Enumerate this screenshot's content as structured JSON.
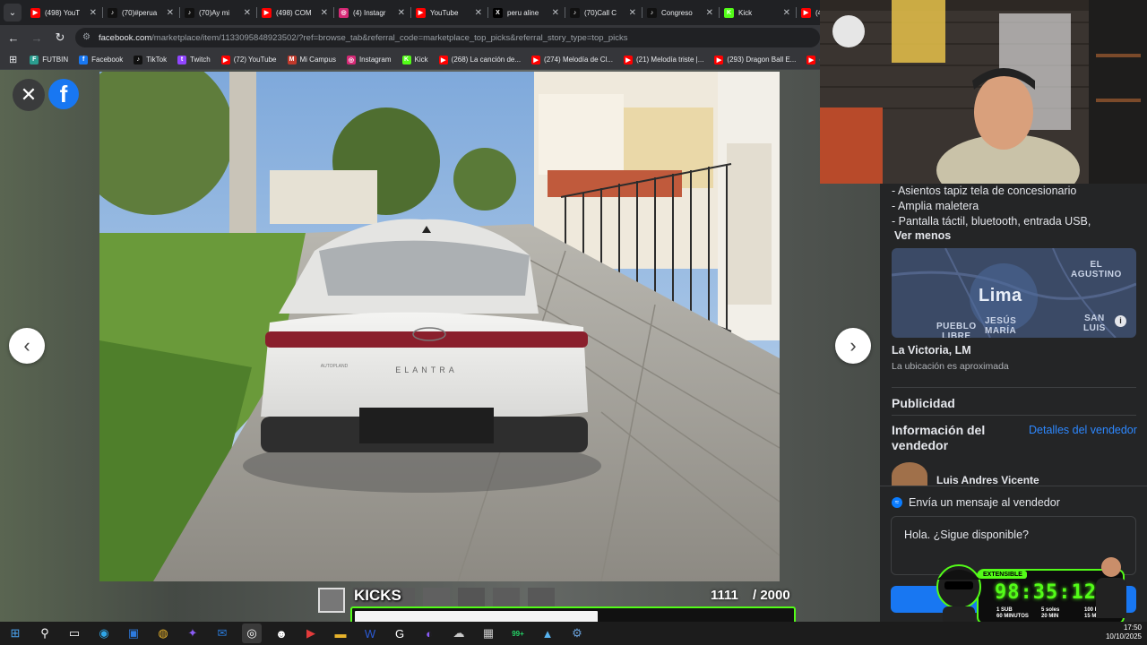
{
  "browser": {
    "tabs": [
      {
        "title": "(498) YouT",
        "icon": "youtube-icon",
        "color": "#ff0000",
        "glyph": "▶"
      },
      {
        "title": "(70)#perua",
        "icon": "tiktok-icon",
        "color": "#111111",
        "glyph": "♪"
      },
      {
        "title": "(70)Ay mi",
        "icon": "tiktok-icon",
        "color": "#111111",
        "glyph": "♪"
      },
      {
        "title": "(498) COM",
        "icon": "youtube-icon",
        "color": "#ff0000",
        "glyph": "▶"
      },
      {
        "title": "(4) Instagr",
        "icon": "instagram-icon",
        "color": "#d62976",
        "glyph": "◎"
      },
      {
        "title": "YouTube",
        "icon": "youtube-icon",
        "color": "#ff0000",
        "glyph": "▶"
      },
      {
        "title": "peru aline",
        "icon": "x-icon",
        "color": "#000000",
        "glyph": "X"
      },
      {
        "title": "(70)Call C",
        "icon": "tiktok-icon",
        "color": "#111111",
        "glyph": "♪"
      },
      {
        "title": "Congreso",
        "icon": "tiktok-icon",
        "color": "#111111",
        "glyph": "♪"
      },
      {
        "title": "Kick",
        "icon": "kick-icon",
        "color": "#53fc18",
        "glyph": "K"
      },
      {
        "title": "(49",
        "icon": "youtube-icon",
        "color": "#ff0000",
        "glyph": "▶"
      }
    ],
    "url_host": "facebook.com",
    "url_path": "/marketplace/item/1133095848923502/?ref=browse_tab&referral_code=marketplace_top_picks&referral_story_type=top_picks",
    "bookmarks": [
      {
        "label": "FUTBIN",
        "color": "#2a9d8f",
        "glyph": "F"
      },
      {
        "label": "Facebook",
        "color": "#1877f2",
        "glyph": "f"
      },
      {
        "label": "TikTok",
        "color": "#111111",
        "glyph": "♪"
      },
      {
        "label": "Twitch",
        "color": "#9146ff",
        "glyph": "t"
      },
      {
        "label": "(72) YouTube",
        "color": "#ff0000",
        "glyph": "▶"
      },
      {
        "label": "Mi Campus",
        "color": "#c0392b",
        "glyph": "M"
      },
      {
        "label": "Instagram",
        "color": "#d62976",
        "glyph": "◎"
      },
      {
        "label": "Kick",
        "color": "#53fc18",
        "glyph": "K"
      },
      {
        "label": "(268) La canción de...",
        "color": "#ff0000",
        "glyph": "▶"
      },
      {
        "label": "(274) Melodía de Cl...",
        "color": "#ff0000",
        "glyph": "▶"
      },
      {
        "label": "(21) Melodía triste |...",
        "color": "#ff0000",
        "glyph": "▶"
      },
      {
        "label": "(293) Dragon Ball E...",
        "color": "#ff0000",
        "glyph": "▶"
      },
      {
        "label": "(",
        "color": "#ff0000",
        "glyph": "▶"
      }
    ]
  },
  "listing": {
    "photo_badge": "ELANTRA",
    "photo_dealer": "AUTOPLAND",
    "description_lines": [
      "- Asientos tapiz tela de concesionario",
      "- Amplia maletera",
      "- Pantalla táctil, bluetooth, entrada USB,"
    ],
    "see_less": "Ver menos",
    "map": {
      "city": "Lima",
      "labels": [
        "EL\nAGUSTINO",
        "PUEBLO\nLIBRE",
        "JESÚS\nMARÍA",
        "SAN\nLUIS"
      ]
    },
    "location": "La Victoria, LM",
    "location_note": "La ubicación es aproximada",
    "ads_heading": "Publicidad",
    "seller_heading": "Información del vendedor",
    "seller_details_link": "Detalles del vendedor",
    "seller_name": "Luis Andres Vicente",
    "message_prompt": "Envía un mensaje al vendedor",
    "message_text": "Hola. ¿Sigue disponible?"
  },
  "overlay": {
    "kicks_title": "KICKS",
    "kicks_current": "1111",
    "kicks_goal": "/ 2000",
    "kicks_progress": 0.5555,
    "timer_tag": "EXTENSIBLE",
    "timer": "98:35:12",
    "stats": [
      "1 SUB\n60 MINUTOS",
      "5 soles\n20 MIN",
      "100 KICKs\n15 MIN"
    ]
  },
  "taskbar": {
    "time": "17:50",
    "date": "10/10/2025",
    "badge": "99+"
  },
  "colors": {
    "facebook_blue": "#1877f2",
    "kick_green": "#53fc18",
    "panel_bg": "#242526",
    "link_blue": "#2d88ff"
  }
}
